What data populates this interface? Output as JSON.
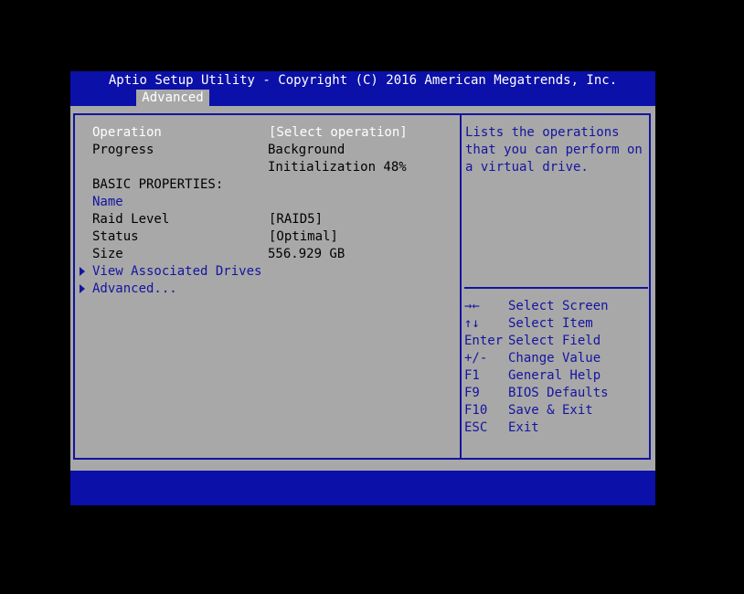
{
  "header": {
    "title": "Aptio Setup Utility - Copyright (C) 2016 American Megatrends, Inc.",
    "tab_label": "Advanced"
  },
  "settings": {
    "operation_label": "Operation",
    "operation_value": "[Select operation]",
    "progress_label": "Progress",
    "progress_value_line1": "Background",
    "progress_value_line2": "Initialization 48%",
    "basic_properties_heading": "BASIC PROPERTIES:",
    "name_label": "Name",
    "raid_level_label": "Raid Level",
    "raid_level_value": "[RAID5]",
    "status_label": "Status",
    "status_value": "[Optimal]",
    "size_label": "Size",
    "size_value": "556.929 GB",
    "view_drives_label": "View Associated Drives",
    "advanced_label": "Advanced..."
  },
  "help": {
    "line1": "Lists the operations",
    "line2": "that you can perform on",
    "line3": "a virtual drive."
  },
  "keys": [
    {
      "key": "→←",
      "desc": "Select Screen"
    },
    {
      "key": "↑↓",
      "desc": "Select Item"
    },
    {
      "key": "Enter",
      "desc": "Select Field"
    },
    {
      "key": "+/-",
      "desc": "Change Value"
    },
    {
      "key": "F1",
      "desc": "General Help"
    },
    {
      "key": "F9",
      "desc": "BIOS Defaults"
    },
    {
      "key": "F10",
      "desc": "Save & Exit"
    },
    {
      "key": "ESC",
      "desc": "Exit"
    }
  ],
  "colors": {
    "bar_blue": "#0b10a8",
    "panel_gray": "#a8a8a8",
    "link_blue": "#1414a0",
    "highlight_white": "#ffffff"
  }
}
